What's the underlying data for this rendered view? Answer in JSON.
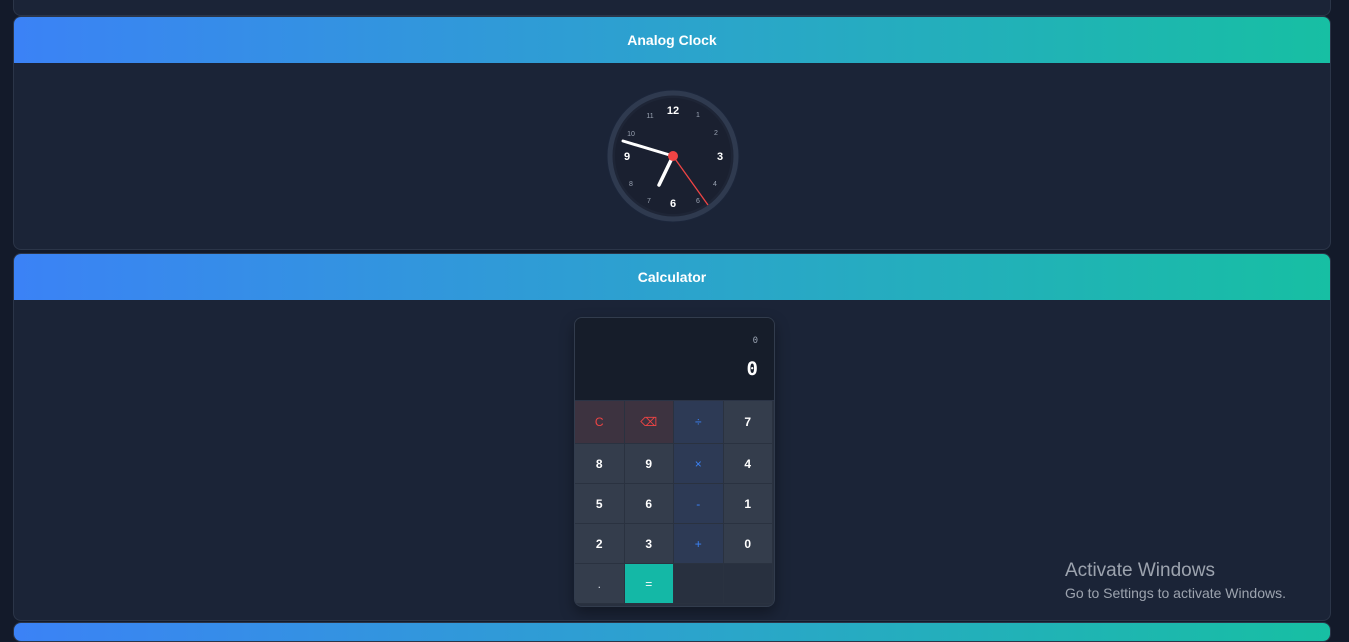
{
  "clock_card": {
    "title": "Analog Clock",
    "numerals": [
      "12",
      "1",
      "2",
      "3",
      "4",
      "6",
      "6",
      "7",
      "8",
      "9",
      "10",
      "11"
    ]
  },
  "calculator_card": {
    "title": "Calculator",
    "display": {
      "previous": "0",
      "current": "0"
    },
    "keys": [
      "C",
      "⌫",
      "÷",
      "7",
      "8",
      "9",
      "×",
      "4",
      "5",
      "6",
      "-",
      "1",
      "2",
      "3",
      "+",
      "0",
      ".",
      "="
    ]
  },
  "watermark": {
    "title": "Activate Windows",
    "subtitle": "Go to Settings to activate Windows."
  },
  "colors": {
    "header_gradient": [
      "#3b82f6",
      "#17bfa3"
    ],
    "clear_key": "#ef4444",
    "operator_key": "#3b82f6",
    "equals_key": "#14b8a6",
    "second_hand": "#ef4444"
  }
}
